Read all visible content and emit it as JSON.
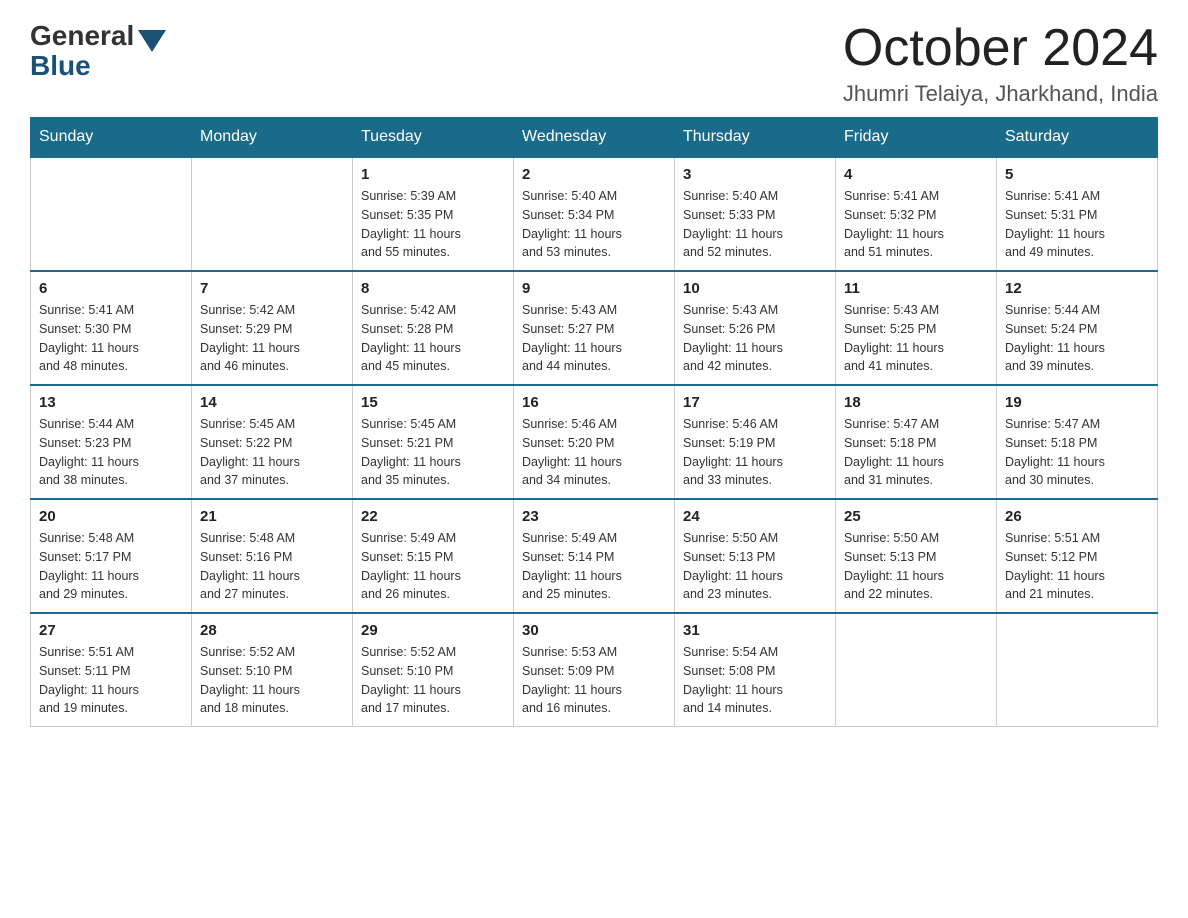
{
  "header": {
    "logo_general": "General",
    "logo_blue": "Blue",
    "month_title": "October 2024",
    "location": "Jhumri Telaiya, Jharkhand, India"
  },
  "days_of_week": [
    "Sunday",
    "Monday",
    "Tuesday",
    "Wednesday",
    "Thursday",
    "Friday",
    "Saturday"
  ],
  "weeks": [
    [
      {
        "day": "",
        "info": ""
      },
      {
        "day": "",
        "info": ""
      },
      {
        "day": "1",
        "info": "Sunrise: 5:39 AM\nSunset: 5:35 PM\nDaylight: 11 hours\nand 55 minutes."
      },
      {
        "day": "2",
        "info": "Sunrise: 5:40 AM\nSunset: 5:34 PM\nDaylight: 11 hours\nand 53 minutes."
      },
      {
        "day": "3",
        "info": "Sunrise: 5:40 AM\nSunset: 5:33 PM\nDaylight: 11 hours\nand 52 minutes."
      },
      {
        "day": "4",
        "info": "Sunrise: 5:41 AM\nSunset: 5:32 PM\nDaylight: 11 hours\nand 51 minutes."
      },
      {
        "day": "5",
        "info": "Sunrise: 5:41 AM\nSunset: 5:31 PM\nDaylight: 11 hours\nand 49 minutes."
      }
    ],
    [
      {
        "day": "6",
        "info": "Sunrise: 5:41 AM\nSunset: 5:30 PM\nDaylight: 11 hours\nand 48 minutes."
      },
      {
        "day": "7",
        "info": "Sunrise: 5:42 AM\nSunset: 5:29 PM\nDaylight: 11 hours\nand 46 minutes."
      },
      {
        "day": "8",
        "info": "Sunrise: 5:42 AM\nSunset: 5:28 PM\nDaylight: 11 hours\nand 45 minutes."
      },
      {
        "day": "9",
        "info": "Sunrise: 5:43 AM\nSunset: 5:27 PM\nDaylight: 11 hours\nand 44 minutes."
      },
      {
        "day": "10",
        "info": "Sunrise: 5:43 AM\nSunset: 5:26 PM\nDaylight: 11 hours\nand 42 minutes."
      },
      {
        "day": "11",
        "info": "Sunrise: 5:43 AM\nSunset: 5:25 PM\nDaylight: 11 hours\nand 41 minutes."
      },
      {
        "day": "12",
        "info": "Sunrise: 5:44 AM\nSunset: 5:24 PM\nDaylight: 11 hours\nand 39 minutes."
      }
    ],
    [
      {
        "day": "13",
        "info": "Sunrise: 5:44 AM\nSunset: 5:23 PM\nDaylight: 11 hours\nand 38 minutes."
      },
      {
        "day": "14",
        "info": "Sunrise: 5:45 AM\nSunset: 5:22 PM\nDaylight: 11 hours\nand 37 minutes."
      },
      {
        "day": "15",
        "info": "Sunrise: 5:45 AM\nSunset: 5:21 PM\nDaylight: 11 hours\nand 35 minutes."
      },
      {
        "day": "16",
        "info": "Sunrise: 5:46 AM\nSunset: 5:20 PM\nDaylight: 11 hours\nand 34 minutes."
      },
      {
        "day": "17",
        "info": "Sunrise: 5:46 AM\nSunset: 5:19 PM\nDaylight: 11 hours\nand 33 minutes."
      },
      {
        "day": "18",
        "info": "Sunrise: 5:47 AM\nSunset: 5:18 PM\nDaylight: 11 hours\nand 31 minutes."
      },
      {
        "day": "19",
        "info": "Sunrise: 5:47 AM\nSunset: 5:18 PM\nDaylight: 11 hours\nand 30 minutes."
      }
    ],
    [
      {
        "day": "20",
        "info": "Sunrise: 5:48 AM\nSunset: 5:17 PM\nDaylight: 11 hours\nand 29 minutes."
      },
      {
        "day": "21",
        "info": "Sunrise: 5:48 AM\nSunset: 5:16 PM\nDaylight: 11 hours\nand 27 minutes."
      },
      {
        "day": "22",
        "info": "Sunrise: 5:49 AM\nSunset: 5:15 PM\nDaylight: 11 hours\nand 26 minutes."
      },
      {
        "day": "23",
        "info": "Sunrise: 5:49 AM\nSunset: 5:14 PM\nDaylight: 11 hours\nand 25 minutes."
      },
      {
        "day": "24",
        "info": "Sunrise: 5:50 AM\nSunset: 5:13 PM\nDaylight: 11 hours\nand 23 minutes."
      },
      {
        "day": "25",
        "info": "Sunrise: 5:50 AM\nSunset: 5:13 PM\nDaylight: 11 hours\nand 22 minutes."
      },
      {
        "day": "26",
        "info": "Sunrise: 5:51 AM\nSunset: 5:12 PM\nDaylight: 11 hours\nand 21 minutes."
      }
    ],
    [
      {
        "day": "27",
        "info": "Sunrise: 5:51 AM\nSunset: 5:11 PM\nDaylight: 11 hours\nand 19 minutes."
      },
      {
        "day": "28",
        "info": "Sunrise: 5:52 AM\nSunset: 5:10 PM\nDaylight: 11 hours\nand 18 minutes."
      },
      {
        "day": "29",
        "info": "Sunrise: 5:52 AM\nSunset: 5:10 PM\nDaylight: 11 hours\nand 17 minutes."
      },
      {
        "day": "30",
        "info": "Sunrise: 5:53 AM\nSunset: 5:09 PM\nDaylight: 11 hours\nand 16 minutes."
      },
      {
        "day": "31",
        "info": "Sunrise: 5:54 AM\nSunset: 5:08 PM\nDaylight: 11 hours\nand 14 minutes."
      },
      {
        "day": "",
        "info": ""
      },
      {
        "day": "",
        "info": ""
      }
    ]
  ]
}
